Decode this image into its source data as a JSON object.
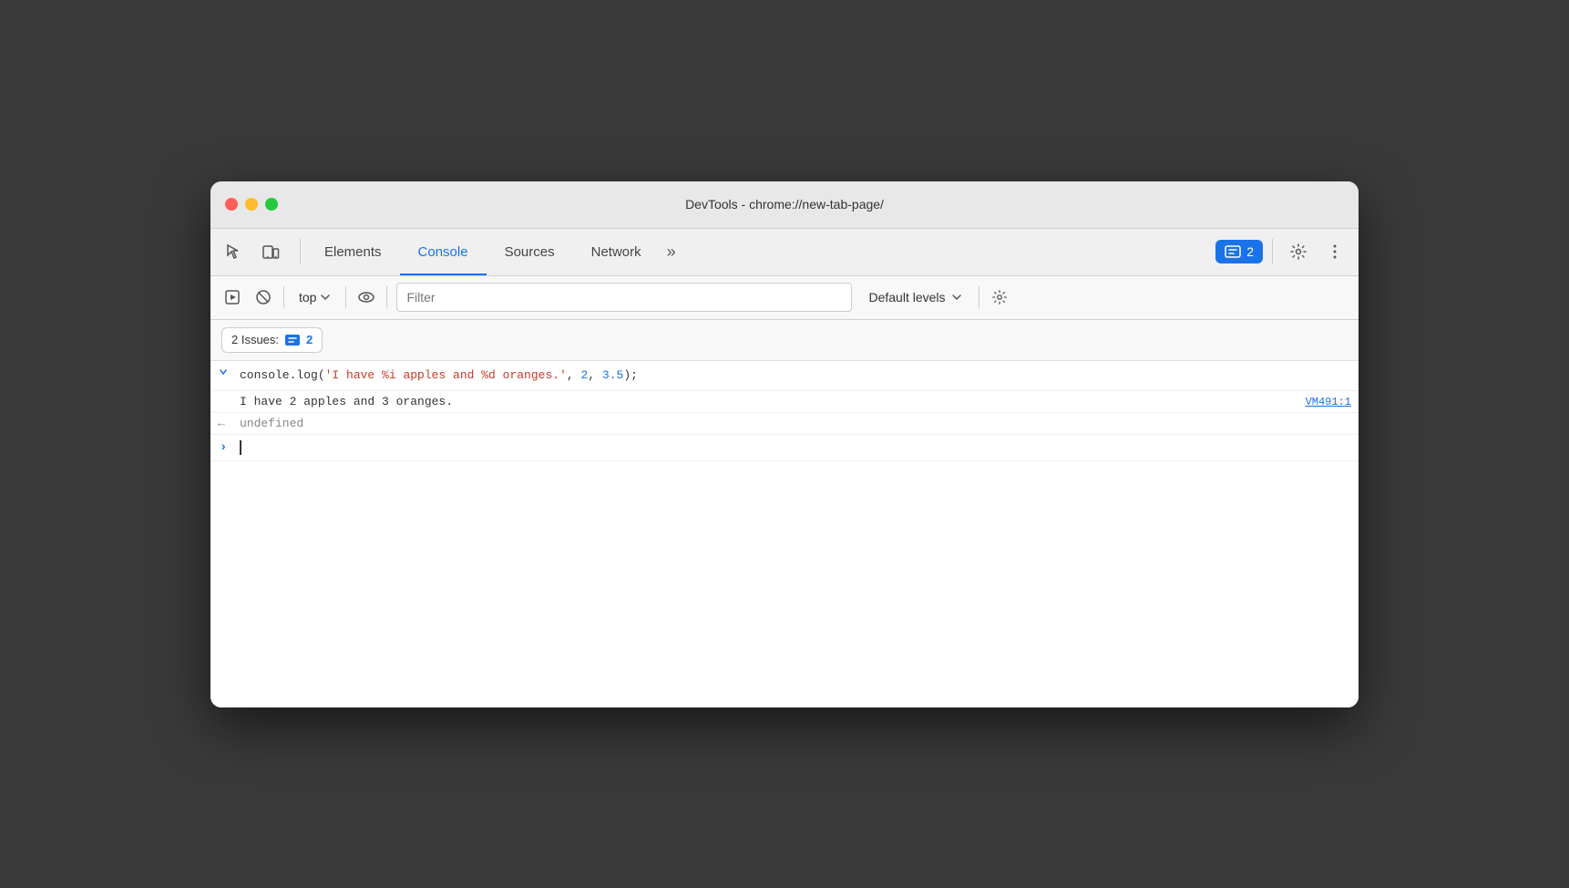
{
  "window": {
    "title": "DevTools - chrome://new-tab-page/"
  },
  "tabs": {
    "items": [
      {
        "id": "elements",
        "label": "Elements",
        "active": false
      },
      {
        "id": "console",
        "label": "Console",
        "active": true
      },
      {
        "id": "sources",
        "label": "Sources",
        "active": false
      },
      {
        "id": "network",
        "label": "Network",
        "active": false
      }
    ],
    "more_label": "»"
  },
  "toolbar": {
    "top_label": "top",
    "filter_placeholder": "Filter",
    "default_levels_label": "Default levels"
  },
  "issues": {
    "bar_label": "2 Issues:",
    "badge_count": "2",
    "badge_count_tab": "2"
  },
  "console_lines": [
    {
      "type": "input",
      "arrow": ">",
      "code_prefix": "console.log(",
      "str": "'I have %i apples and %d oranges.'",
      "code_suffix": ", ",
      "num1": "2",
      "sep": ", ",
      "num2": "3.5",
      "code_end": ");"
    },
    {
      "type": "output",
      "text": "I have 2 apples and 3 oranges.",
      "source": "VM491:1"
    },
    {
      "type": "return",
      "arrow": "←",
      "text": "undefined"
    },
    {
      "type": "prompt",
      "arrow": ">"
    }
  ]
}
